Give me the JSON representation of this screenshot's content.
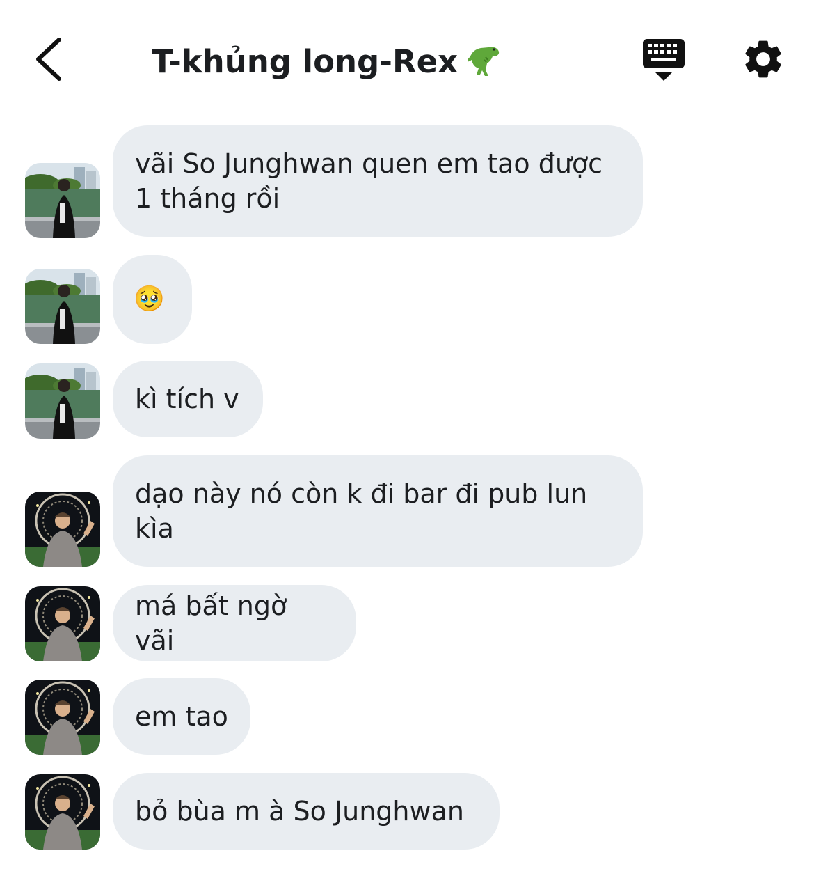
{
  "header": {
    "title": "T-khủng long-Rex",
    "title_emoji": "t-rex-emoji",
    "back_icon": "chevron-left-icon",
    "keyboard_icon": "keyboard-hide-icon",
    "settings_icon": "gear-icon"
  },
  "colors": {
    "bubble_bg": "#e9edf1",
    "text": "#1c1e21",
    "icon": "#111111"
  },
  "messages": [
    {
      "sender_avatar": "avatar-lake",
      "text": "vãi So Junghwan quen em tao được 1 tháng rồi"
    },
    {
      "sender_avatar": "avatar-lake",
      "text": "🥹"
    },
    {
      "sender_avatar": "avatar-lake",
      "text": "kì tích v"
    },
    {
      "sender_avatar": "avatar-ferris",
      "text": "dạo này nó còn k đi bar đi pub lun kìa"
    },
    {
      "sender_avatar": "avatar-ferris",
      "text": "má bất ngờ vãi"
    },
    {
      "sender_avatar": "avatar-ferris",
      "text": "em tao"
    },
    {
      "sender_avatar": "avatar-ferris",
      "text": "bỏ bùa m à So Junghwan"
    }
  ]
}
